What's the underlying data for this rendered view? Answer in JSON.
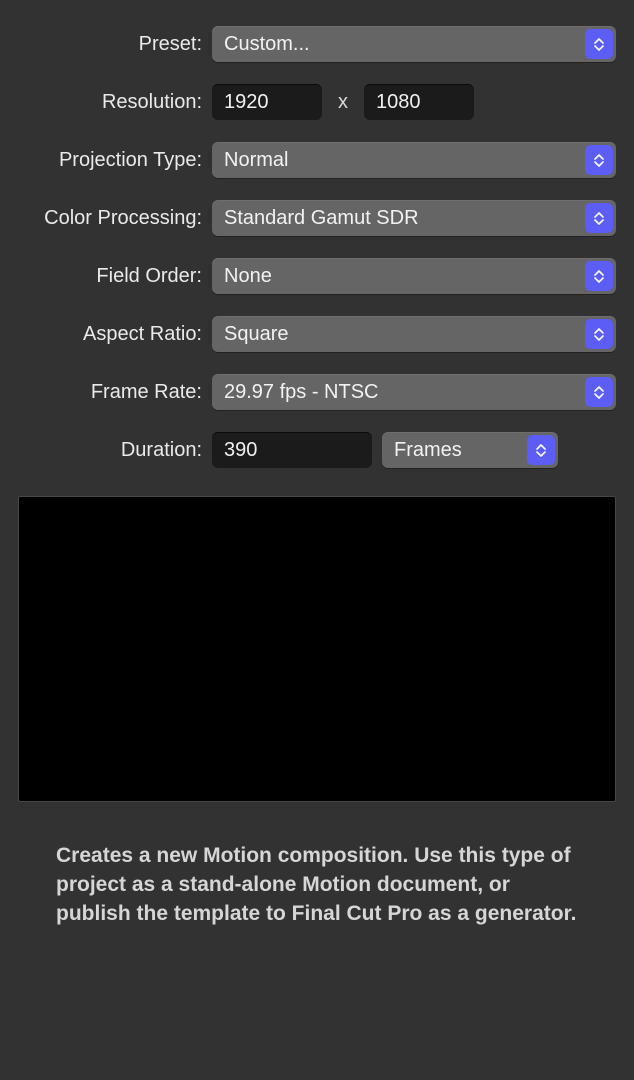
{
  "labels": {
    "preset": "Preset:",
    "resolution": "Resolution:",
    "projection": "Projection Type:",
    "color": "Color Processing:",
    "field": "Field Order:",
    "aspect": "Aspect Ratio:",
    "framerate": "Frame Rate:",
    "duration": "Duration:",
    "x": "x"
  },
  "values": {
    "preset": "Custom...",
    "res_w": "1920",
    "res_h": "1080",
    "projection": "Normal",
    "color": "Standard Gamut SDR",
    "field": "None",
    "aspect": "Square",
    "framerate": "29.97 fps - NTSC",
    "duration": "390",
    "duration_unit": "Frames"
  },
  "description": "Creates a new Motion composition. Use this type of project as a stand-alone Motion document, or publish the template to Final Cut Pro as a generator."
}
